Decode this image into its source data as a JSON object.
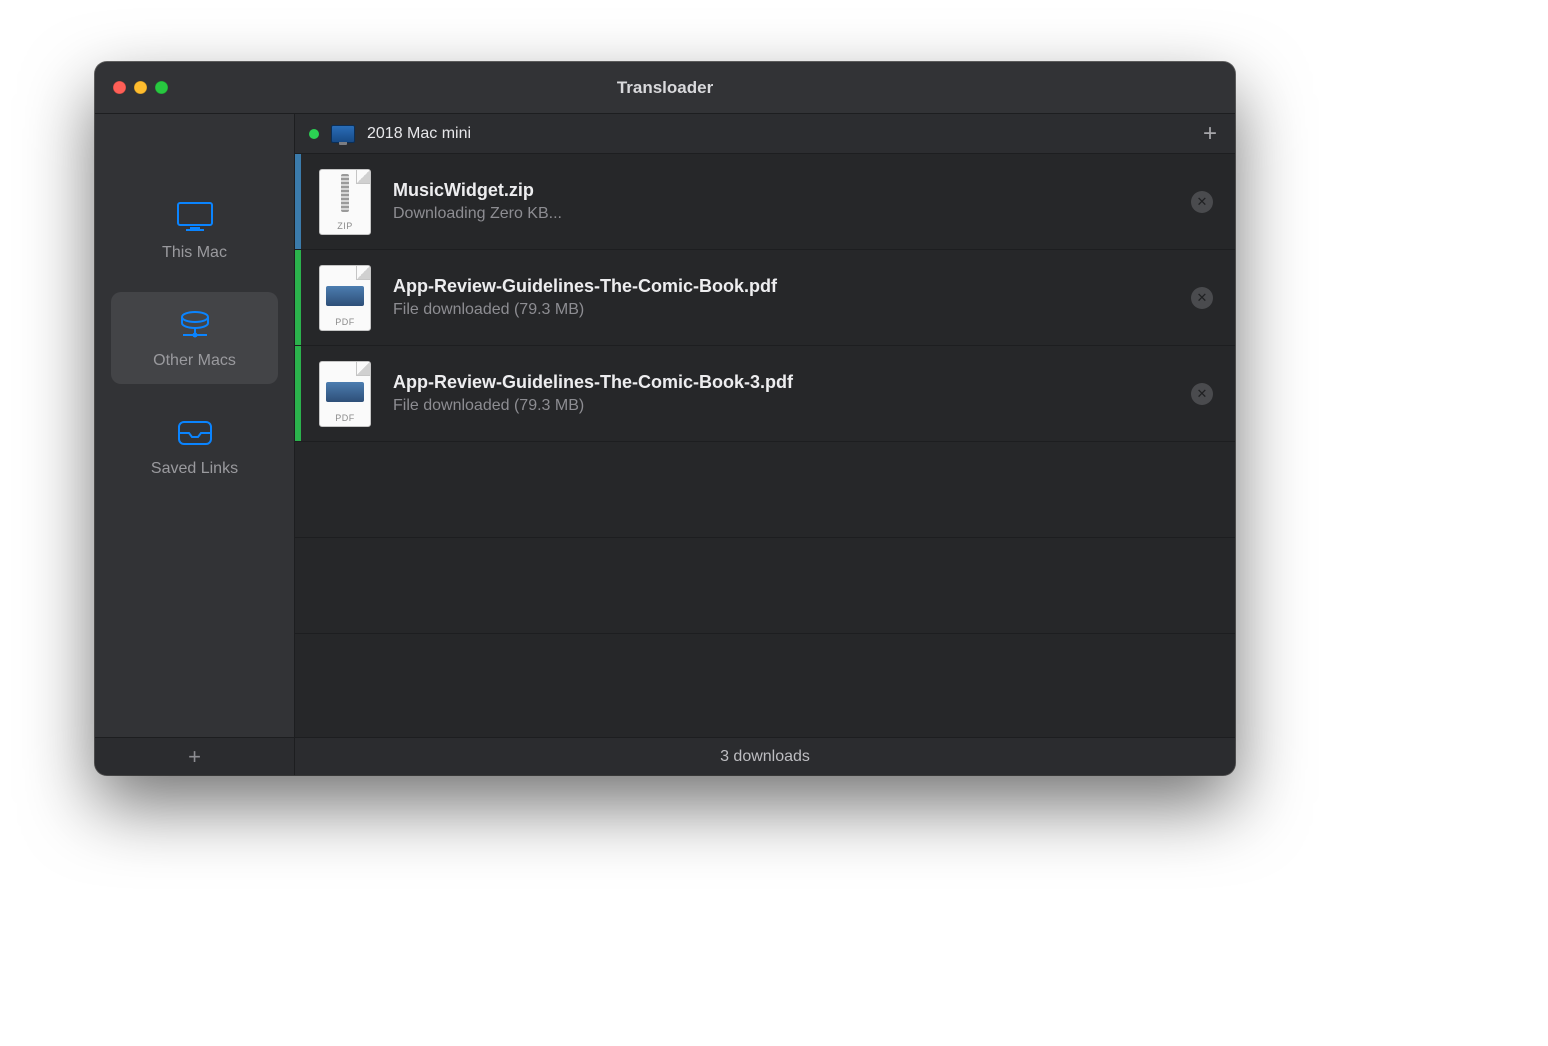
{
  "window": {
    "title": "Transloader"
  },
  "sidebar": {
    "items": [
      {
        "id": "this-mac",
        "label": "This Mac"
      },
      {
        "id": "other-macs",
        "label": "Other Macs"
      },
      {
        "id": "saved-links",
        "label": "Saved Links"
      }
    ],
    "selected_index": 1
  },
  "source": {
    "name": "2018 Mac mini",
    "online": true
  },
  "downloads": [
    {
      "filename": "MusicWidget.zip",
      "status": "Downloading Zero KB...",
      "kind": "zip",
      "ext_label": "ZIP",
      "progress_state": "in_progress",
      "stripe_color": "blue"
    },
    {
      "filename": "App-Review-Guidelines-The-Comic-Book.pdf",
      "status": "File downloaded (79.3 MB)",
      "kind": "pdf",
      "ext_label": "PDF",
      "progress_state": "done",
      "stripe_color": "green"
    },
    {
      "filename": "App-Review-Guidelines-The-Comic-Book-3.pdf",
      "status": "File downloaded (79.3 MB)",
      "kind": "pdf",
      "ext_label": "PDF",
      "progress_state": "done",
      "stripe_color": "green"
    }
  ],
  "footer": {
    "summary": "3 downloads"
  },
  "icons": {
    "plus": "+",
    "close": "✕"
  },
  "colors": {
    "accent": "#0a84ff",
    "online": "#2bd153",
    "stripe_blue": "#3b7bab",
    "stripe_green": "#2bb24c"
  }
}
